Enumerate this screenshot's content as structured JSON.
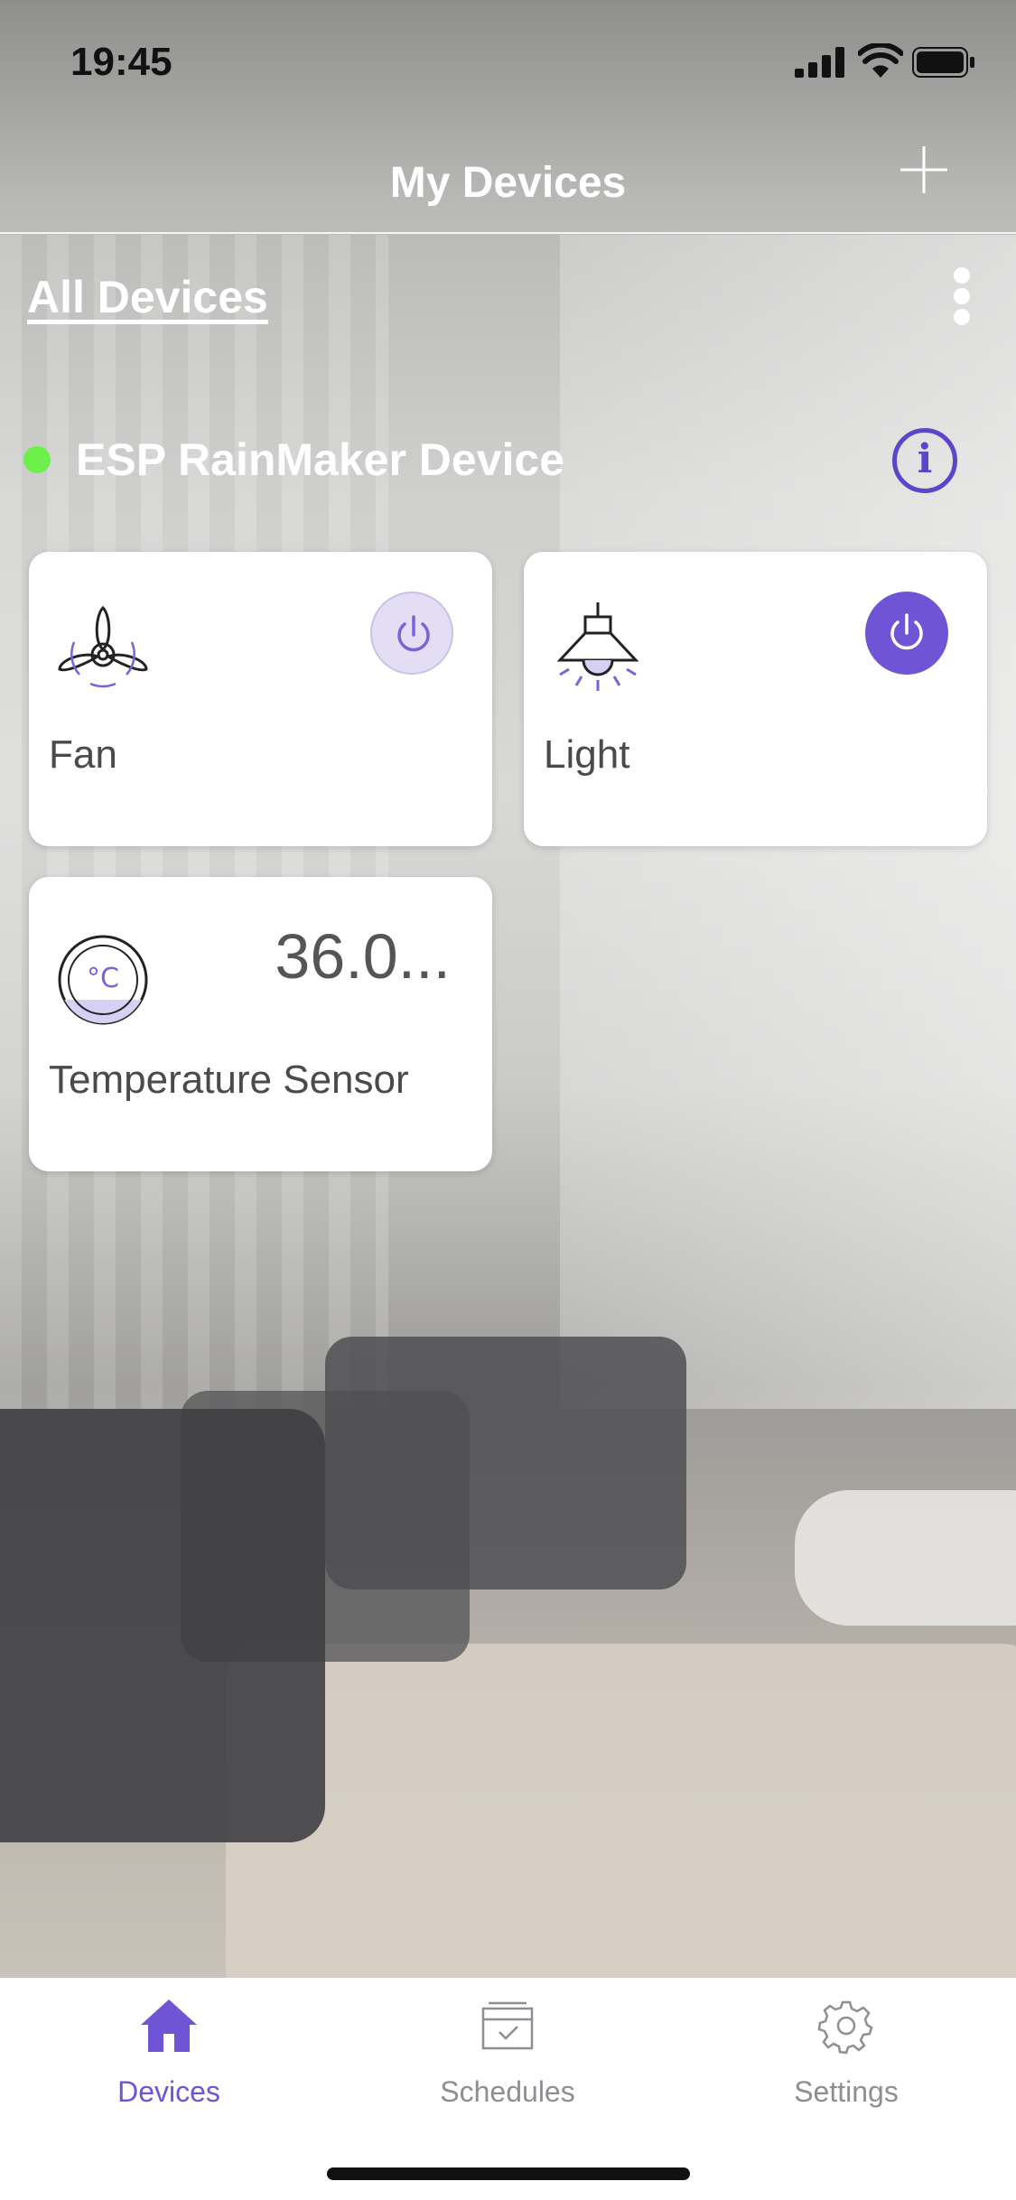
{
  "status": {
    "time": "19:45"
  },
  "nav": {
    "title": "My Devices",
    "add_icon": "plus-icon"
  },
  "filter": {
    "label": "All Devices",
    "more_icon": "more-vertical-icon"
  },
  "group": {
    "name": "ESP RainMaker Device",
    "online": true,
    "status_color": "#6df04a",
    "info_icon": "info-icon"
  },
  "devices": [
    {
      "name": "Fan",
      "icon": "fan-icon",
      "power": "off"
    },
    {
      "name": "Light",
      "icon": "light-icon",
      "power": "on"
    },
    {
      "name": "Temperature Sensor",
      "icon": "thermometer-icon",
      "value": "36.0..."
    }
  ],
  "tabs": [
    {
      "label": "Devices",
      "icon": "home-icon",
      "active": true
    },
    {
      "label": "Schedules",
      "icon": "schedule-icon",
      "active": false
    },
    {
      "label": "Settings",
      "icon": "gear-icon",
      "active": false
    }
  ],
  "colors": {
    "accent": "#6f55d6",
    "inactive": "#8e8e93"
  }
}
